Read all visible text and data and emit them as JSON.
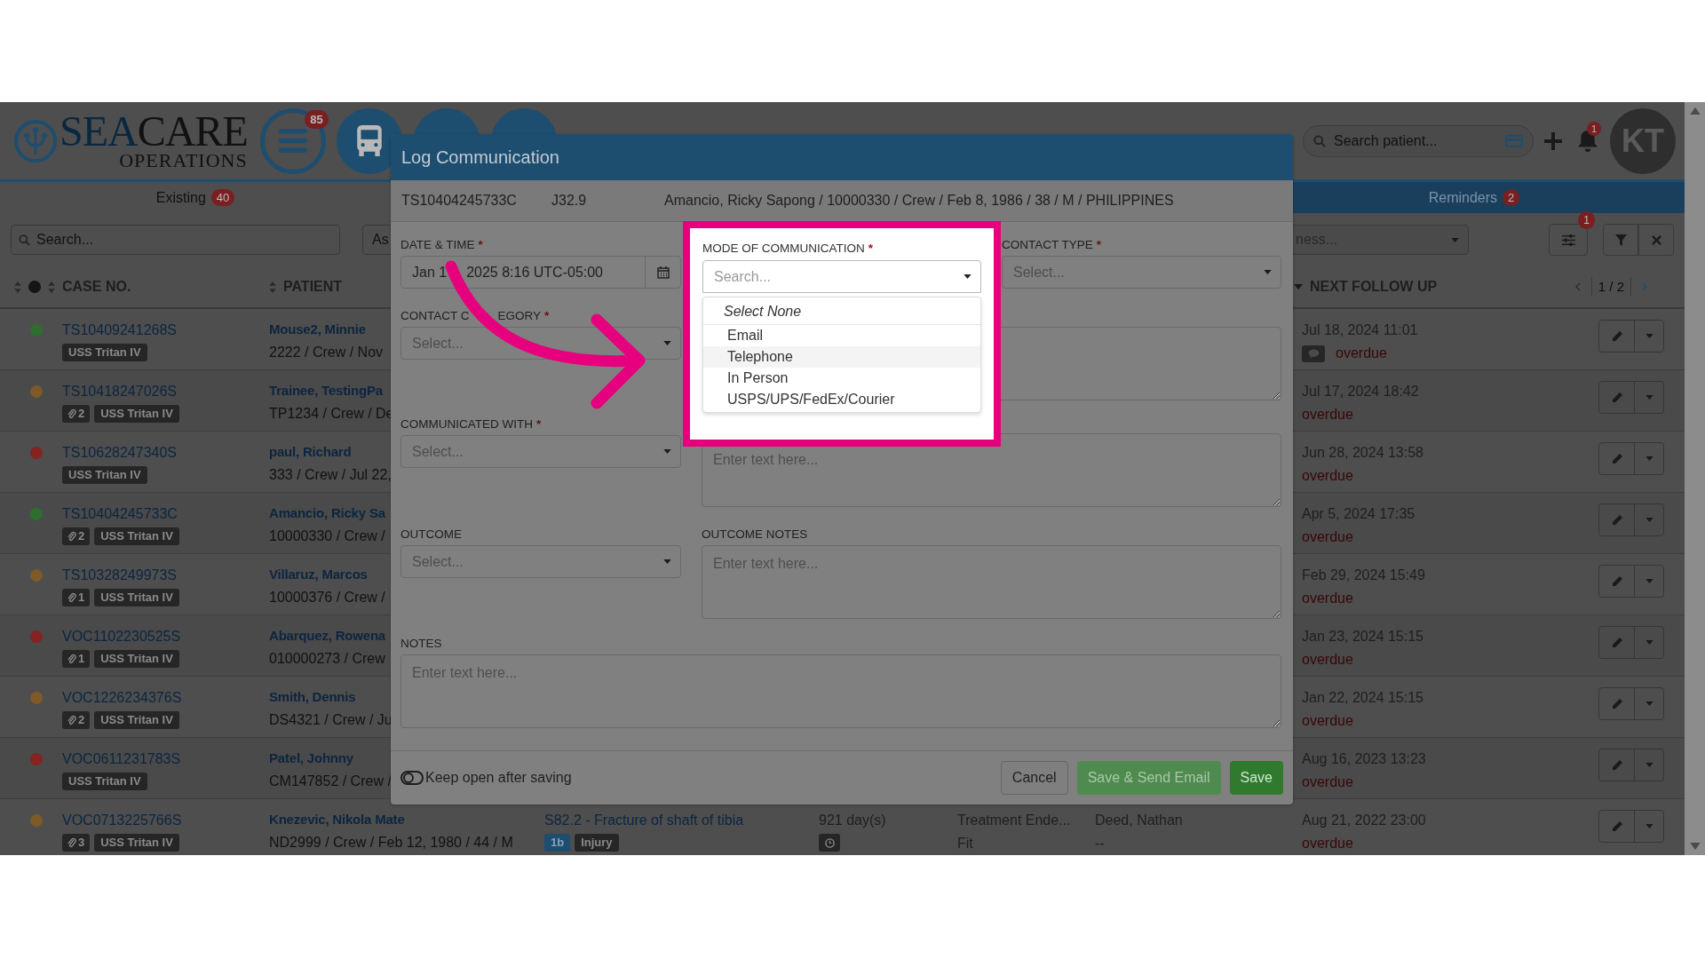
{
  "header": {
    "logo": {
      "word_1": "SEA",
      "word_2": "CARE",
      "tagline": "OPERATIONS"
    },
    "menu_badge": "85",
    "search": {
      "placeholder": "Search patient..."
    },
    "notifications_badge": "1",
    "avatar": "KT"
  },
  "tabs": [
    {
      "label": "Existing",
      "count": "40",
      "selected": true
    },
    {
      "label": "Reminders",
      "count": "2",
      "selected": false
    }
  ],
  "filters": {
    "search": {
      "placeholder": "Search..."
    },
    "field_2": {
      "placeholder": "As"
    },
    "field_3": {
      "value": "ness..."
    },
    "filter_badge": "1"
  },
  "table": {
    "columns": [
      "CASE NO.",
      "PATIENT",
      "NEXT FOLLOW UP"
    ],
    "pagination": "1 / 2",
    "rows": [
      {
        "color": "#2e6e2e",
        "case_no": "TS10409241268S",
        "attachments": "",
        "vessel": "USS Tritan IV",
        "patient": "Mouse2, Minnie",
        "details": "2222 / Crew / Nov",
        "follow_up": "Jul 18, 2024 11:01",
        "comment": true,
        "overdue": "overdue"
      },
      {
        "color": "#7d5a28",
        "case_no": "TS10418247026S",
        "attachments": "2",
        "vessel": "USS Tritan IV",
        "patient": "Trainee, TestingPa",
        "details": "TP1234 / Crew / De",
        "follow_up": "Jul 17, 2024 18:42",
        "comment": false,
        "overdue": "overdue"
      },
      {
        "color": "#852222",
        "case_no": "TS10628247340S",
        "attachments": "",
        "vessel": "USS Tritan IV",
        "patient": "paul, Richard",
        "details": "333 / Crew / Jul 22,",
        "follow_up": "Jun 28, 2024 13:58",
        "comment": false,
        "overdue": "overdue"
      },
      {
        "color": "#2e6e2e",
        "case_no": "TS10404245733C",
        "attachments": "2",
        "vessel": "USS Tritan IV",
        "patient": "Amancio, Ricky Sa",
        "details": "10000330 / Crew /",
        "follow_up": "Apr 5, 2024 17:35",
        "comment": false,
        "overdue": "overdue"
      },
      {
        "color": "#7d5a28",
        "case_no": "TS10328249973S",
        "attachments": "1",
        "vessel": "USS Tritan IV",
        "patient": "Villaruz, Marcos",
        "details": "10000376 / Crew /",
        "follow_up": "Feb 29, 2024 15:49",
        "comment": false,
        "overdue": "overdue"
      },
      {
        "color": "#852222",
        "case_no": "VOC1102230525S",
        "attachments": "1",
        "vessel": "USS Tritan IV",
        "patient": "Abarquez, Rowena",
        "details": "010000273 / Crew",
        "follow_up": "Jan 23, 2024 15:15",
        "comment": false,
        "overdue": "overdue"
      },
      {
        "color": "#7d5a28",
        "case_no": "VOC1226234376S",
        "attachments": "2",
        "vessel": "USS Tritan IV",
        "patient": "Smith, Dennis",
        "details": "DS4321 / Crew / Ju",
        "follow_up": "Jan 22, 2024 15:15",
        "comment": false,
        "overdue": "overdue"
      },
      {
        "color": "#852222",
        "case_no": "VOC0611231783S",
        "attachments": "",
        "vessel": "USS Tritan IV",
        "patient": "Patel, Johnny",
        "details": "CM147852 / Crew /",
        "follow_up": "Aug 16, 2023 13:23",
        "comment": false,
        "overdue": "overdue"
      },
      {
        "color": "#7d5a28",
        "case_no": "VOC0713225766S",
        "attachments": "3",
        "vessel": "USS Tritan IV",
        "patient": "Knezevic, Nikola Mate",
        "details": "ND2999 / Crew / Feb 12, 1980 / 44 / M",
        "diagnosis": "S82.2 - Fracture of shaft of tibia",
        "diagnosis_tags": [
          "1b",
          "Injury"
        ],
        "days": "921 day(s)",
        "status": "Treatment Ende...",
        "status_2": "Fit",
        "doctor": "Deed, Nathan",
        "doctor_2": "--",
        "follow_up": "Aug 21, 2022 23:00",
        "comment": false,
        "overdue": "overdue"
      }
    ]
  },
  "modal": {
    "title": "Log Communication",
    "case_info": [
      "TS10404245733C",
      "J32.9",
      "Amancio, Ricky Sapong / 10000330 / Crew / Feb 8, 1986 / 38 / M / PHILIPPINES"
    ],
    "date_time": {
      "label": "DATE & TIME",
      "required_mark": "*",
      "value_parts": [
        "Jan 1",
        "2025 8:16 UTC-05:00"
      ]
    },
    "mode_of_communication": {
      "label": "MODE OF COMMUNICATION",
      "required_mark": "*",
      "placeholder": "Search...",
      "expanded": true,
      "options": [
        {
          "label": "Select None",
          "kind": "none",
          "highlighted": false
        },
        {
          "label": "Email",
          "kind": "option",
          "highlighted": false
        },
        {
          "label": "Telephone",
          "kind": "option",
          "highlighted": true
        },
        {
          "label": "In Person",
          "kind": "option",
          "highlighted": false
        },
        {
          "label": "USPS/UPS/FedEx/Courier",
          "kind": "option",
          "highlighted": false
        }
      ]
    },
    "contact_type": {
      "label": "CONTACT TYPE",
      "required_mark": "*",
      "placeholder": "Select..."
    },
    "contact_category": {
      "label_parts": [
        "CONTACT C",
        "EGORY"
      ],
      "required_mark": "*",
      "placeholder": "Select..."
    },
    "communicated_with": {
      "label": "COMMUNICATED WITH",
      "required_mark": "*",
      "placeholder": "Select..."
    },
    "field_6": {
      "placeholder": "Enter text here..."
    },
    "outcome": {
      "label": "OUTCOME",
      "placeholder": "Select..."
    },
    "outcome_notes": {
      "label": "OUTCOME NOTES",
      "placeholder": "Enter text here..."
    },
    "notes": {
      "label": "NOTES",
      "placeholder": "Enter text here..."
    },
    "keep_open": {
      "label": "Keep open after saving",
      "on": false
    },
    "buttons": [
      {
        "label": "Cancel",
        "kind": "default"
      },
      {
        "label": "Save & Send Email",
        "kind": "secondary"
      },
      {
        "label": "Save",
        "kind": "primary"
      }
    ]
  }
}
